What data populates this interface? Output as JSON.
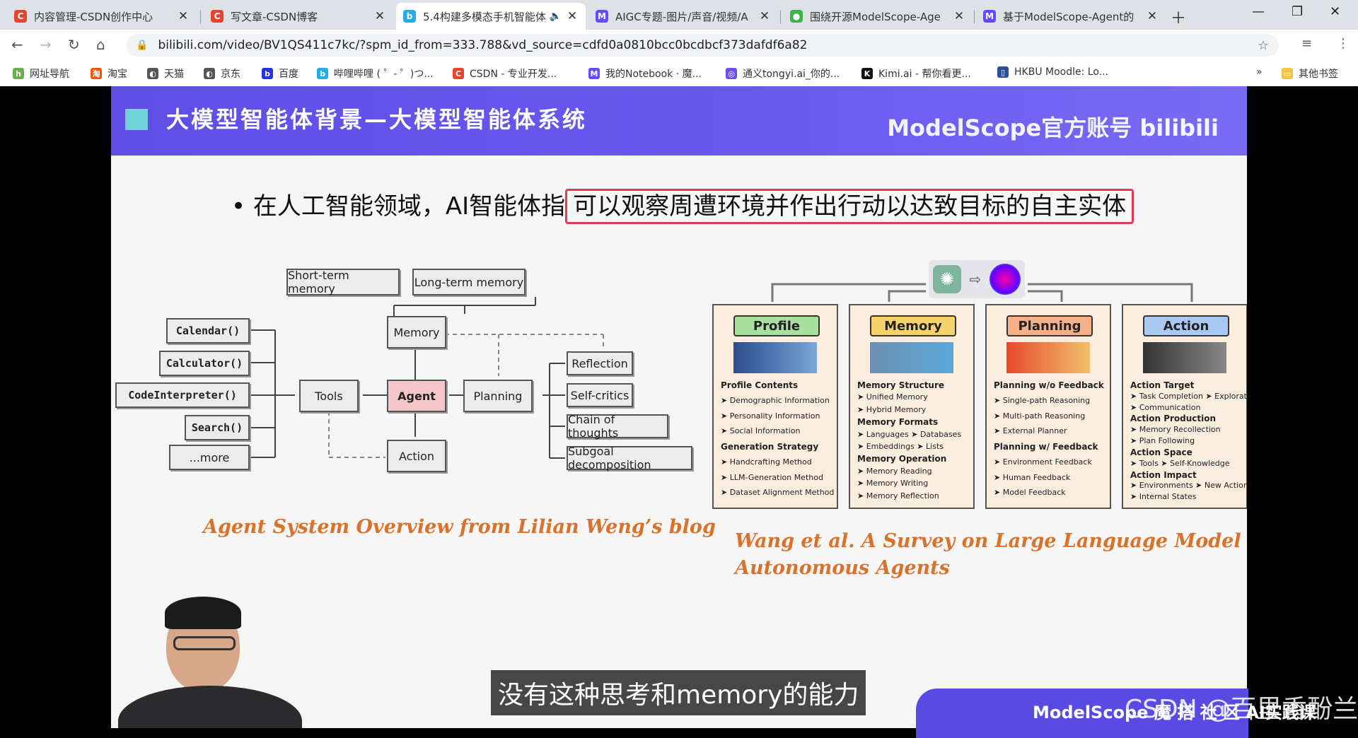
{
  "tabs": [
    {
      "title": "内容管理-CSDN创作中心",
      "icon": "csdn-icon",
      "color": "#e8432d",
      "letter": "C"
    },
    {
      "title": "写文章-CSDN博客",
      "icon": "csdn-icon",
      "color": "#e8432d",
      "letter": "C"
    },
    {
      "title": "5.4构建多模态手机智能体",
      "icon": "bilibili-icon",
      "color": "#23ade5",
      "letter": "b"
    },
    {
      "title": "AIGC专题-图片/声音/视频/A",
      "icon": "modelscope-icon",
      "color": "#624aff",
      "letter": "M"
    },
    {
      "title": "围绕开源ModelScope-Age",
      "icon": "leaf-icon",
      "color": "#3cb44b",
      "letter": "●"
    },
    {
      "title": "基于ModelScope-Agent的",
      "icon": "modelscope-icon",
      "color": "#624aff",
      "letter": "M"
    }
  ],
  "url": "bilibili.com/video/BV1QS411c7kc/?spm_id_from=333.788&vd_source=cdfd0a0810bcc0bcdbcf373dafdf6a82",
  "bookmarks": [
    {
      "label": "网址导航",
      "color": "#6ab04c",
      "letter": "h"
    },
    {
      "label": "淘宝",
      "color": "#ff5000",
      "letter": "淘"
    },
    {
      "label": "天猫",
      "color": "#555",
      "letter": "◐"
    },
    {
      "label": "京东",
      "color": "#555",
      "letter": "◐"
    },
    {
      "label": "百度",
      "color": "#2932e1",
      "letter": "b"
    },
    {
      "label": "哔哩哔哩 ( ゜- ゜)つ...",
      "color": "#23ade5",
      "letter": "b"
    },
    {
      "label": "CSDN - 专业开发...",
      "color": "#e8432d",
      "letter": "C"
    },
    {
      "label": "我的Notebook · 魔...",
      "color": "#624aff",
      "letter": "M"
    },
    {
      "label": "通义tongyi.ai_你的...",
      "color": "#6d4ee6",
      "letter": "◎"
    },
    {
      "label": "Kimi.ai - 帮你看更...",
      "color": "#111",
      "letter": "K"
    },
    {
      "label": "HKBU Moodle: Lo...",
      "color": "#2a4f9c",
      "letter": "▯"
    }
  ],
  "bookmarks_more": "»",
  "other_bookmarks": "其他书签",
  "slide": {
    "title": "大模型智能体背景—大模型智能体系统",
    "brand": "ModelScope官方账号 bilibili",
    "bullet_prefix": "在人工智能领域，AI智能体指",
    "bullet_highlight": "可以观察周遭环境并作出行动以达致目标的自主实体",
    "left_diagram": {
      "short_term": "Short-term memory",
      "long_term": "Long-term memory",
      "memory": "Memory",
      "tools": "Tools",
      "agent": "Agent",
      "planning": "Planning",
      "action": "Action",
      "calendar": "Calendar()",
      "calculator": "Calculator()",
      "code_interpreter": "CodeInterpreter()",
      "search": "Search()",
      "more": "...more",
      "reflection": "Reflection",
      "self_critics": "Self-critics",
      "chain": "Chain of thoughts",
      "subgoal": "Subgoal decomposition"
    },
    "left_caption": "Agent System Overview from Lilian Weng’s blog",
    "right_caption_1": "Wang et al. A Survey on Large Language Model based",
    "right_caption_2": "Autonomous Agents",
    "cards": [
      {
        "title": "Profile",
        "lines": [
          {
            "t": "Profile Contents",
            "b": true
          },
          {
            "t": "➤ Demographic Information"
          },
          {
            "t": "➤ Personality Information"
          },
          {
            "t": "➤ Social Information"
          },
          {
            "t": "Generation Strategy",
            "b": true
          },
          {
            "t": "➤ Handcrafting Method"
          },
          {
            "t": "➤ LLM-Generation Method"
          },
          {
            "t": "➤ Dataset Alignment Method"
          }
        ]
      },
      {
        "title": "Memory",
        "lines": [
          {
            "t": "Memory Structure",
            "b": true
          },
          {
            "t": "➤ Unified Memory"
          },
          {
            "t": "➤ Hybrid Memory"
          },
          {
            "t": "Memory Formats",
            "b": true
          },
          {
            "t": "➤ Languages  ➤ Databases"
          },
          {
            "t": "➤ Embeddings  ➤ Lists"
          },
          {
            "t": "Memory Operation",
            "b": true
          },
          {
            "t": "➤ Memory Reading"
          },
          {
            "t": "➤ Memory Writing"
          },
          {
            "t": "➤ Memory Reflection"
          }
        ]
      },
      {
        "title": "Planning",
        "lines": [
          {
            "t": "Planning w/o Feedback",
            "b": true
          },
          {
            "t": "➤ Single-path Reasoning"
          },
          {
            "t": "➤ Multi-path Reasoning"
          },
          {
            "t": "➤ External Planner"
          },
          {
            "t": "Planning w/ Feedback",
            "b": true
          },
          {
            "t": "➤ Environment Feedback"
          },
          {
            "t": "➤ Human Feedback"
          },
          {
            "t": "➤ Model Feedback"
          }
        ]
      },
      {
        "title": "Action",
        "lines": [
          {
            "t": "Action Target",
            "b": true
          },
          {
            "t": "➤ Task Completion ➤ Exploration"
          },
          {
            "t": "➤ Communication"
          },
          {
            "t": "Action Production",
            "b": true
          },
          {
            "t": "➤ Memory Recollection"
          },
          {
            "t": "➤ Plan Following"
          },
          {
            "t": "Action Space",
            "b": true
          },
          {
            "t": "➤ Tools  ➤ Self-Knowledge"
          },
          {
            "t": "Action Impact",
            "b": true
          },
          {
            "t": "➤ Environments ➤ New Actions"
          },
          {
            "t": "➤ Internal States"
          }
        ]
      }
    ],
    "subtitle": "没有这种思考和memory的能力",
    "footer_brand": "ModelScope 魔 搭 社 区 AI实践课",
    "watermark": "CSDN @百里香酚兰"
  }
}
